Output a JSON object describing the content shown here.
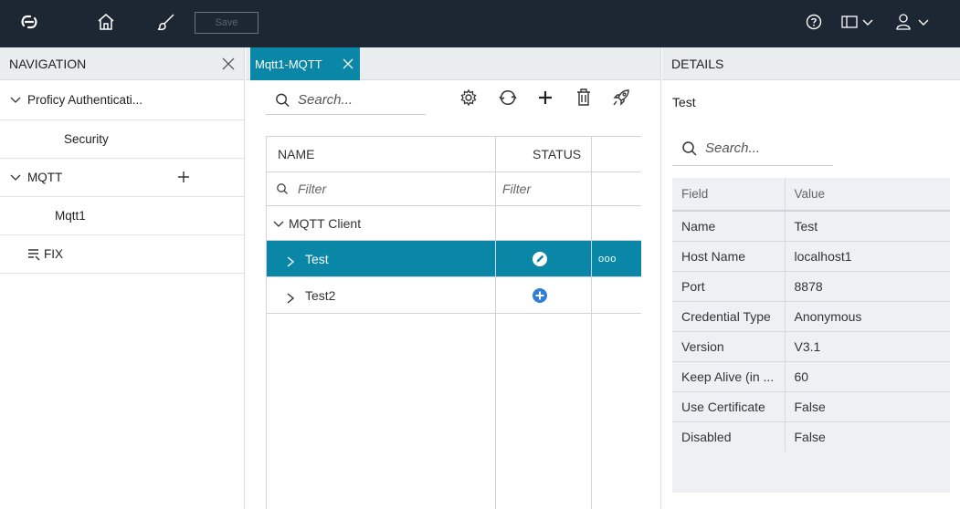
{
  "topbar": {
    "save_label": "Save",
    "icons": [
      "logo-icon",
      "home-icon",
      "brush-icon",
      "help-icon",
      "panel-toggle-icon",
      "user-icon"
    ]
  },
  "navigation": {
    "title": "NAVIGATION",
    "items": [
      {
        "label": "Proficy Authenticati...",
        "level": 0,
        "expanded": true
      },
      {
        "label": "Security",
        "level": 1
      },
      {
        "label": "MQTT",
        "level": 0,
        "expanded": true
      },
      {
        "label": "Mqtt1",
        "level": 1
      },
      {
        "label": "FIX",
        "level": 0
      }
    ]
  },
  "main": {
    "tab_label": "Mqtt1-MQTT",
    "search_placeholder": "Search...",
    "grid": {
      "columns": [
        "NAME",
        "STATUS"
      ],
      "filter_placeholders": [
        "Filter",
        "Filter"
      ],
      "group_label": "MQTT Client",
      "rows": [
        {
          "name": "Test",
          "status": "edit",
          "selected": true,
          "more": "ooo"
        },
        {
          "name": "Test2",
          "status": "add",
          "selected": false
        }
      ]
    }
  },
  "details": {
    "title": "DETAILS",
    "item_name": "Test",
    "search_placeholder": "Search...",
    "columns": [
      "Field",
      "Value"
    ],
    "properties": [
      {
        "field": "Name",
        "value": "Test"
      },
      {
        "field": "Host Name",
        "value": "localhost1"
      },
      {
        "field": "Port",
        "value": "8878"
      },
      {
        "field": "Credential Type",
        "value": "Anonymous"
      },
      {
        "field": "Version",
        "value": "V3.1"
      },
      {
        "field": "Keep Alive (in ...",
        "value": "60"
      },
      {
        "field": "Use Certificate",
        "value": "False"
      },
      {
        "field": "Disabled",
        "value": "False"
      }
    ]
  },
  "colors": {
    "topbar": "#1d2633",
    "accent": "#0a86a7",
    "panel_header": "#eaedf0"
  }
}
